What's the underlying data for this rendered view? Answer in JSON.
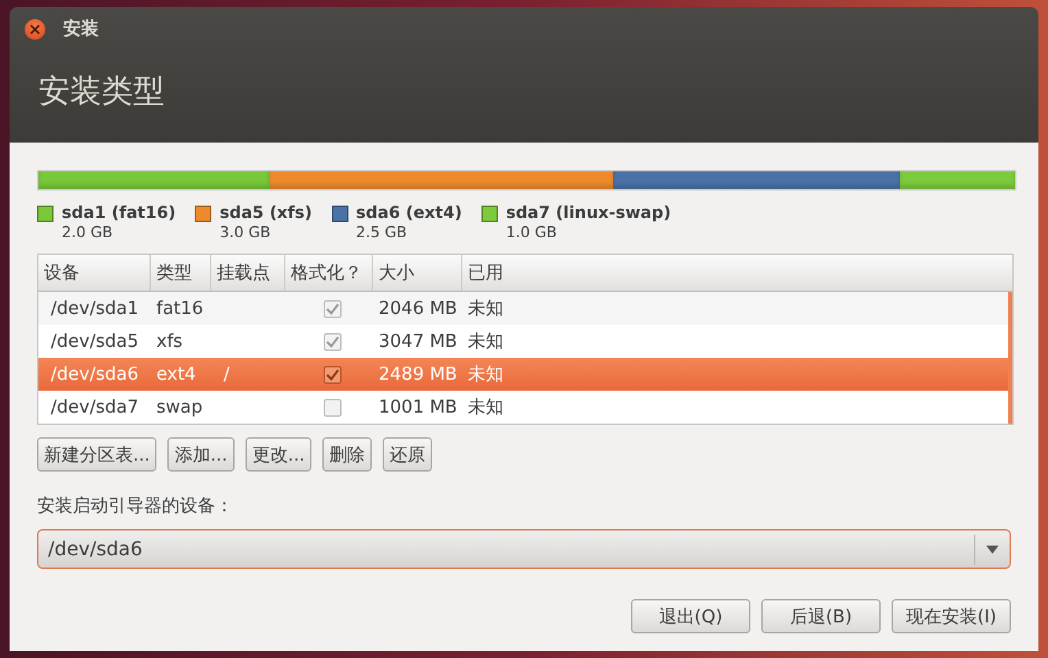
{
  "window": {
    "title": "安装"
  },
  "heading": "安装类型",
  "partitions": [
    {
      "name": "sda1 (fat16)",
      "size": "2.0 GB",
      "color": "#78c83a"
    },
    {
      "name": "sda5 (xfs)",
      "size": "3.0 GB",
      "color": "#ee8a2c"
    },
    {
      "name": "sda6 (ext4)",
      "size": "2.5 GB",
      "color": "#4a72a8"
    },
    {
      "name": "sda7 (linux-swap)",
      "size": "1.0 GB",
      "color": "#7ccb3c"
    }
  ],
  "table": {
    "columns": [
      "设备",
      "类型",
      "挂载点",
      "格式化？",
      "大小",
      "已用"
    ],
    "rows": [
      {
        "device": "/dev/sda1",
        "type": "fat16",
        "format_checked": true,
        "size": "2046 MB",
        "used": "未知",
        "selected": false
      },
      {
        "device": "/dev/sda5",
        "type": "xfs",
        "format_checked": true,
        "size": "3047 MB",
        "used": "未知",
        "selected": false
      },
      {
        "device": "/dev/sda6",
        "type": "ext4",
        "mount": "/",
        "format_checked": true,
        "size": "2489 MB",
        "used": "未知",
        "selected": true
      },
      {
        "device": "/dev/sda7",
        "type": "swap",
        "format_checked": false,
        "size": "1001 MB",
        "used": "未知",
        "selected": false
      }
    ]
  },
  "table_buttons": [
    "新建分区表...",
    "添加...",
    "更改...",
    "删除",
    "还原"
  ],
  "bootloader": {
    "label": "安装启动引导器的设备：",
    "value": "/dev/sda6"
  },
  "actions": [
    "退出(Q)",
    "后退(B)",
    "现在安装(I)"
  ]
}
